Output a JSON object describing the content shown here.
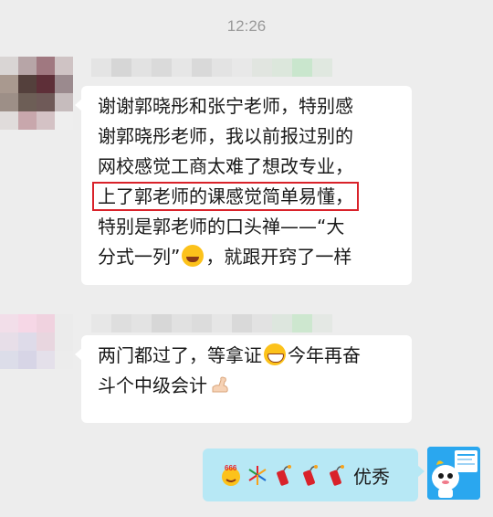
{
  "chat": {
    "timestamp": "12:26",
    "messages": [
      {
        "sender": "other",
        "lines": [
          "谢谢郭晓彤和张宁老师，特别感",
          "谢郭晓彤老师，我以前报过别的",
          "网校感觉工商太难了想改专业，",
          "上了郭老师的课感觉简单易懂，",
          "特别是郭老师的口头禅——“大",
          "分式一列”",
          "，就跟开窍了一样"
        ]
      },
      {
        "sender": "other",
        "lines": [
          "两门都过了，等拿证",
          "今年再奋",
          "斗个中级会计"
        ]
      },
      {
        "sender": "self",
        "text": "优秀"
      }
    ],
    "emojis": {
      "laugh": "laughing-tears-icon",
      "grin": "grin-icon",
      "muscle": "muscle-arm-icon",
      "six": "666-icon",
      "firework": "firework-icon",
      "firecracker": "firecracker-icon"
    },
    "colors": {
      "background": "#ededed",
      "bubble_other": "#ffffff",
      "bubble_self": "#b7e8f5",
      "highlight_border": "#d9222a",
      "timestamp": "#999999"
    }
  }
}
